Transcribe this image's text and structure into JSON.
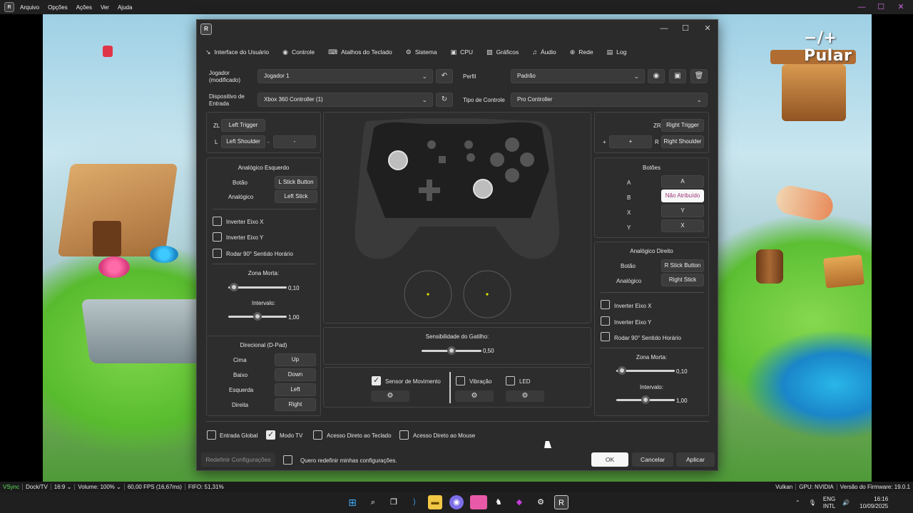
{
  "menu": {
    "logo": "R",
    "items": [
      "Arquivo",
      "Opções",
      "Ações",
      "Ver",
      "Ajuda"
    ]
  },
  "game": {
    "skip_hint": "−/+ Pular"
  },
  "dialog": {
    "logo": "R",
    "tabs": [
      {
        "icon": "↘",
        "label": "Interface do Usuário"
      },
      {
        "icon": "◉",
        "label": "Controle"
      },
      {
        "icon": "⌨",
        "label": "Atalhos do Teclado"
      },
      {
        "icon": "⚙",
        "label": "Sistema"
      },
      {
        "icon": "▣",
        "label": "CPU"
      },
      {
        "icon": "▨",
        "label": "Gráficos"
      },
      {
        "icon": "♫",
        "label": "Áudio"
      },
      {
        "icon": "⊕",
        "label": "Rede"
      },
      {
        "icon": "▤",
        "label": "Log"
      }
    ],
    "player_label": "Jogador (modificado)",
    "player_value": "Jogador 1",
    "profile_label": "Perfil",
    "profile_value": "Padrão",
    "device_label": "Dispositivo de Entrada",
    "device_value": "Xbox 360 Controller (1)",
    "type_label": "Tipo de Controle",
    "type_value": "Pro Controller",
    "left_top": {
      "zl_label": "ZL",
      "zl_btn": "Left Trigger",
      "l_label": "L",
      "l_btn": "Left Shoulder",
      "minus_label": "-",
      "minus_btn": "-"
    },
    "right_top": {
      "zr_label": "ZR",
      "zr_btn": "Right Trigger",
      "plus_label": "+",
      "plus_btn": "+",
      "r_label": "R",
      "r_btn": "Right Shoulder"
    },
    "left_stick": {
      "title": "Analógico Esquerdo",
      "button_label": "Botão",
      "button_value": "L Stick Button",
      "stick_label": "Analógico",
      "stick_value": "Left Stick",
      "invert_x": "Inverter Eixo X",
      "invert_y": "Inverter Eixo Y",
      "rotate": "Rodar 90° Sentido Horário",
      "deadzone_label": "Zona Morta:",
      "deadzone_value": "0,10",
      "range_label": "Intervalo:",
      "range_value": "1,00",
      "deadzone_level": 0.1,
      "range_level": 0.5
    },
    "dpad": {
      "title": "Direcional (D-Pad)",
      "up_label": "Cima",
      "up_value": "Up",
      "down_label": "Baixo",
      "down_value": "Down",
      "left_label": "Esquerda",
      "left_value": "Left",
      "right_label": "Direita",
      "right_value": "Right"
    },
    "buttons": {
      "title": "Botões",
      "a_label": "A",
      "a_value": "A",
      "b_label": "B",
      "b_value": "Não Atribuído",
      "x_label": "X",
      "x_value": "Y",
      "y_label": "Y",
      "y_value": "X"
    },
    "right_stick": {
      "title": "Analógico Direito",
      "button_label": "Botão",
      "button_value": "R Stick Button",
      "stick_label": "Analógico",
      "stick_value": "Right Stick",
      "invert_x": "Inverter Eixo X",
      "invert_y": "Inverter Eixo Y",
      "rotate": "Rodar 90° Sentido Horário",
      "deadzone_label": "Zona Morta:",
      "deadzone_value": "0,10",
      "range_label": "Intervalo:",
      "range_value": "1,00",
      "deadzone_level": 0.1,
      "range_level": 0.5
    },
    "trigger": {
      "label": "Sensibilidade do Gatilho:",
      "value": "0,50",
      "level": 0.5
    },
    "motion": {
      "motion_label": "Sensor de Movimento",
      "vibration_label": "Vibração",
      "led_label": "LED"
    },
    "options": {
      "global_input": "Entrada Global",
      "tv_mode": "Modo TV",
      "keyboard_direct": "Acesso Direto ao Teclado",
      "mouse_direct": "Acesso Direto ao Mouse"
    },
    "footer": {
      "reset_btn": "Redefinir Configurações",
      "reset_confirm": "Quero redefinir minhas configurações.",
      "ok": "OK",
      "cancel": "Cancelar",
      "apply": "Aplicar"
    }
  },
  "statusbar": {
    "vsync": "VSync",
    "dock": "Dock/TV",
    "aspect": "16:9",
    "volume": "Volume: 100%",
    "fps": "60,00 FPS (16,67ms)",
    "fifo": "FIFO: 51,31%",
    "api": "Vulkan",
    "gpu": "GPU: NVIDIA",
    "firmware": "Versão do Firmware: 19.0.1"
  },
  "taskbar": {
    "lang": "ENG",
    "layout": "INTL",
    "time": "16:16",
    "date": "10/09/2025"
  },
  "colors": {
    "accent": "#c86adc",
    "vsync": "#5ee05e",
    "dialog_bg": "#2b2b2b",
    "stick_dot": "#e6e600"
  }
}
